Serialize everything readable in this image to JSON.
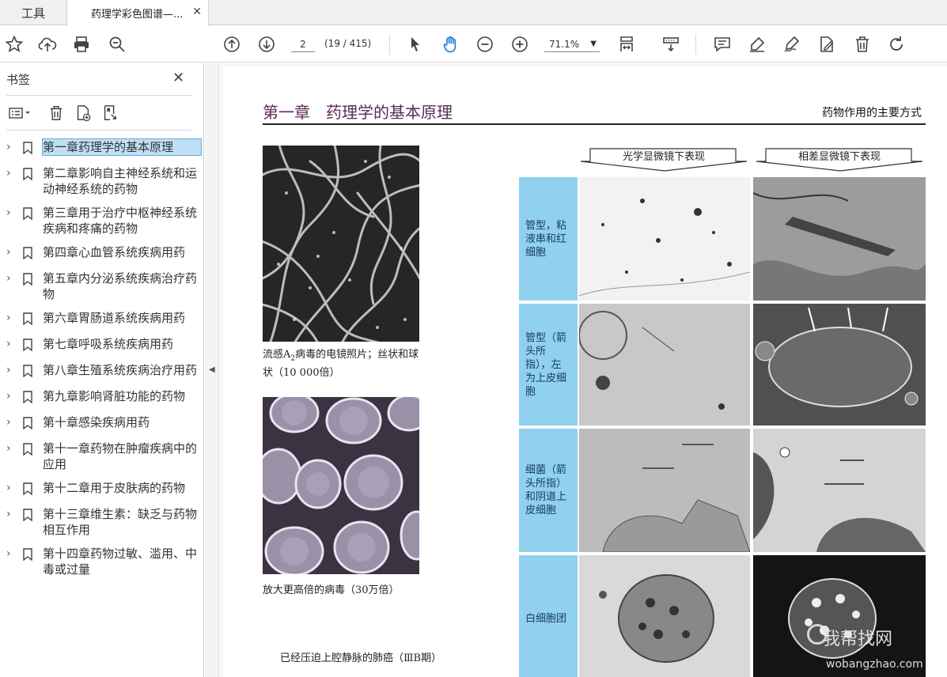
{
  "tabs": {
    "tools": "工具",
    "document": "药理学彩色图谱—...",
    "close_glyph": "✕"
  },
  "toolbar": {
    "page_value": "2",
    "page_count": "(19 / 415)",
    "zoom": "71.1%",
    "icons": [
      "star-icon",
      "upload-icon",
      "print-icon",
      "zoom-search-icon",
      "page-up-icon",
      "page-down-icon",
      "select-arrow-icon",
      "hand-icon",
      "zoom-out-icon",
      "zoom-in-icon",
      "fit-page-icon",
      "scroll-mode-icon",
      "comment-icon",
      "highlight-icon",
      "sign-icon",
      "edit-icon",
      "delete-icon",
      "rotate-icon"
    ]
  },
  "sidebar": {
    "title": "书签",
    "items": [
      {
        "label": "第一章药理学的基本原理",
        "selected": true
      },
      {
        "label": "第二章影响自主神经系统和运动神经系统的药物"
      },
      {
        "label": "第三章用于治疗中枢神经系统疾病和疼痛的药物"
      },
      {
        "label": "第四章心血管系统疾病用药"
      },
      {
        "label": "第五章内分泌系统疾病治疗药物"
      },
      {
        "label": "第六章胃肠道系统疾病用药"
      },
      {
        "label": "第七章呼吸系统疾病用药"
      },
      {
        "label": "第八章生殖系统疾病治疗用药"
      },
      {
        "label": "第九章影响肾脏功能的药物"
      },
      {
        "label": "第十章感染疾病用药"
      },
      {
        "label": "第十一章药物在肿瘤疾病中的应用"
      },
      {
        "label": "第十二章用于皮肤病的药物"
      },
      {
        "label": "第十三章维生素：缺乏与药物相互作用"
      },
      {
        "label": "第十四章药物过敏、滥用、中毒或过量"
      }
    ]
  },
  "page": {
    "chapter_title": "第一章　药理学的基本原理",
    "section_title": "药物作用的主要方式",
    "caption1": "流感A",
    "caption1_sub": "2",
    "caption1_rest": "病毒的电镜照片；丝状和球状（10 000倍）",
    "caption2": "放大更高倍的病毒（30万倍）",
    "caption3": "已经压迫上腔静脉的肺癌（ⅢB期）",
    "col_heads": [
      "光学显微镜下表现",
      "相差显微镜下表现"
    ],
    "row_labels": [
      "管型，粘液串和红细胞",
      "管型（箭头所指），左为上皮细胞",
      "细菌（箭头所指）和阴道上皮细胞",
      "白细胞团"
    ],
    "watermark": "我帮找网",
    "watermark_url": "wobangzhao.com"
  }
}
